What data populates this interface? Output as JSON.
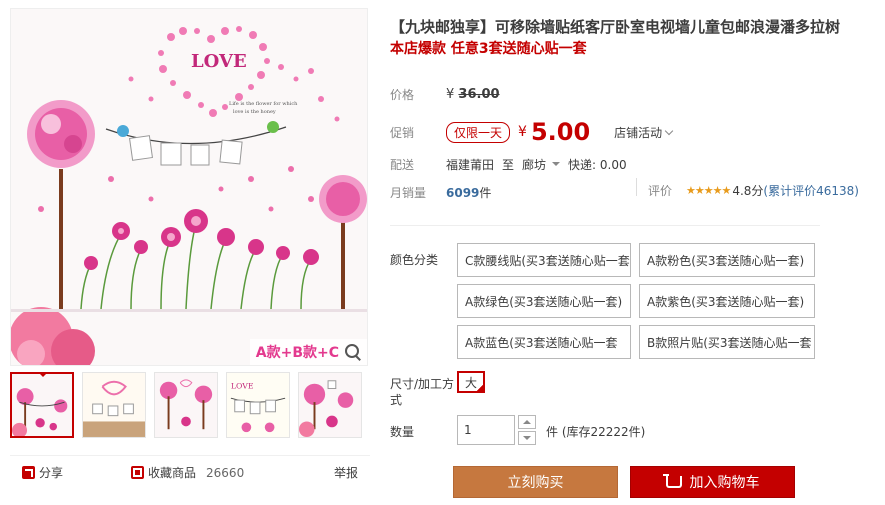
{
  "gallery": {
    "banner_text": "A款+B款+C",
    "image_text": {
      "love": "LOVE",
      "caption_line1": "Life is the flower for which",
      "caption_line2": "love is the honey"
    },
    "thumbnail_count": 5
  },
  "actions": {
    "share_label": "分享",
    "collect_label": "收藏商品",
    "collect_count": "26660",
    "report_label": "举报"
  },
  "product": {
    "title": "【九块邮独享】可移除墙贴纸客厅卧室电视墙儿童包邮浪漫潘多拉树",
    "subtitle": "本店爆款 任意3套送随心贴一套"
  },
  "price": {
    "label": "价格",
    "currency": "¥",
    "original": "36.00",
    "promo_label": "促销",
    "promo_tag": "仅限一天",
    "promo_price": "5.00",
    "shop_event": "店铺活动"
  },
  "shipping": {
    "label": "配送",
    "from": "福建莆田",
    "to_word": "至",
    "to": "廊坊",
    "express": "快递: 0.00"
  },
  "sales": {
    "label": "月销量",
    "count": "6099",
    "unit": "件",
    "rating_label": "评价",
    "stars": "★★★★★",
    "score": "4.8分",
    "review_text": "(累计评价46138)"
  },
  "specs": {
    "color_label": "颜色分类",
    "color_options": [
      "C款腰线贴(买3套送随心贴一套",
      "A款粉色(买3套送随心贴一套)",
      "A款绿色(买3套送随心贴一套)",
      "A款紫色(买3套送随心贴一套)",
      "A款蓝色(买3套送随心贴一套",
      "B款照片贴(买3套送随心贴一套"
    ],
    "size_label_line1": "尺寸/加工方",
    "size_label_line2": "式",
    "size_option": "大"
  },
  "quantity": {
    "label": "数量",
    "value": "1",
    "stock_text": "件 (库存22222件)"
  },
  "buttons": {
    "buy_now": "立刻购买",
    "add_cart": "加入购物车"
  },
  "colors": {
    "accent_red": "#c40000",
    "buy_orange": "#c6783f",
    "link_blue": "#3a6b9d",
    "flower_pink": "#e3398e"
  }
}
